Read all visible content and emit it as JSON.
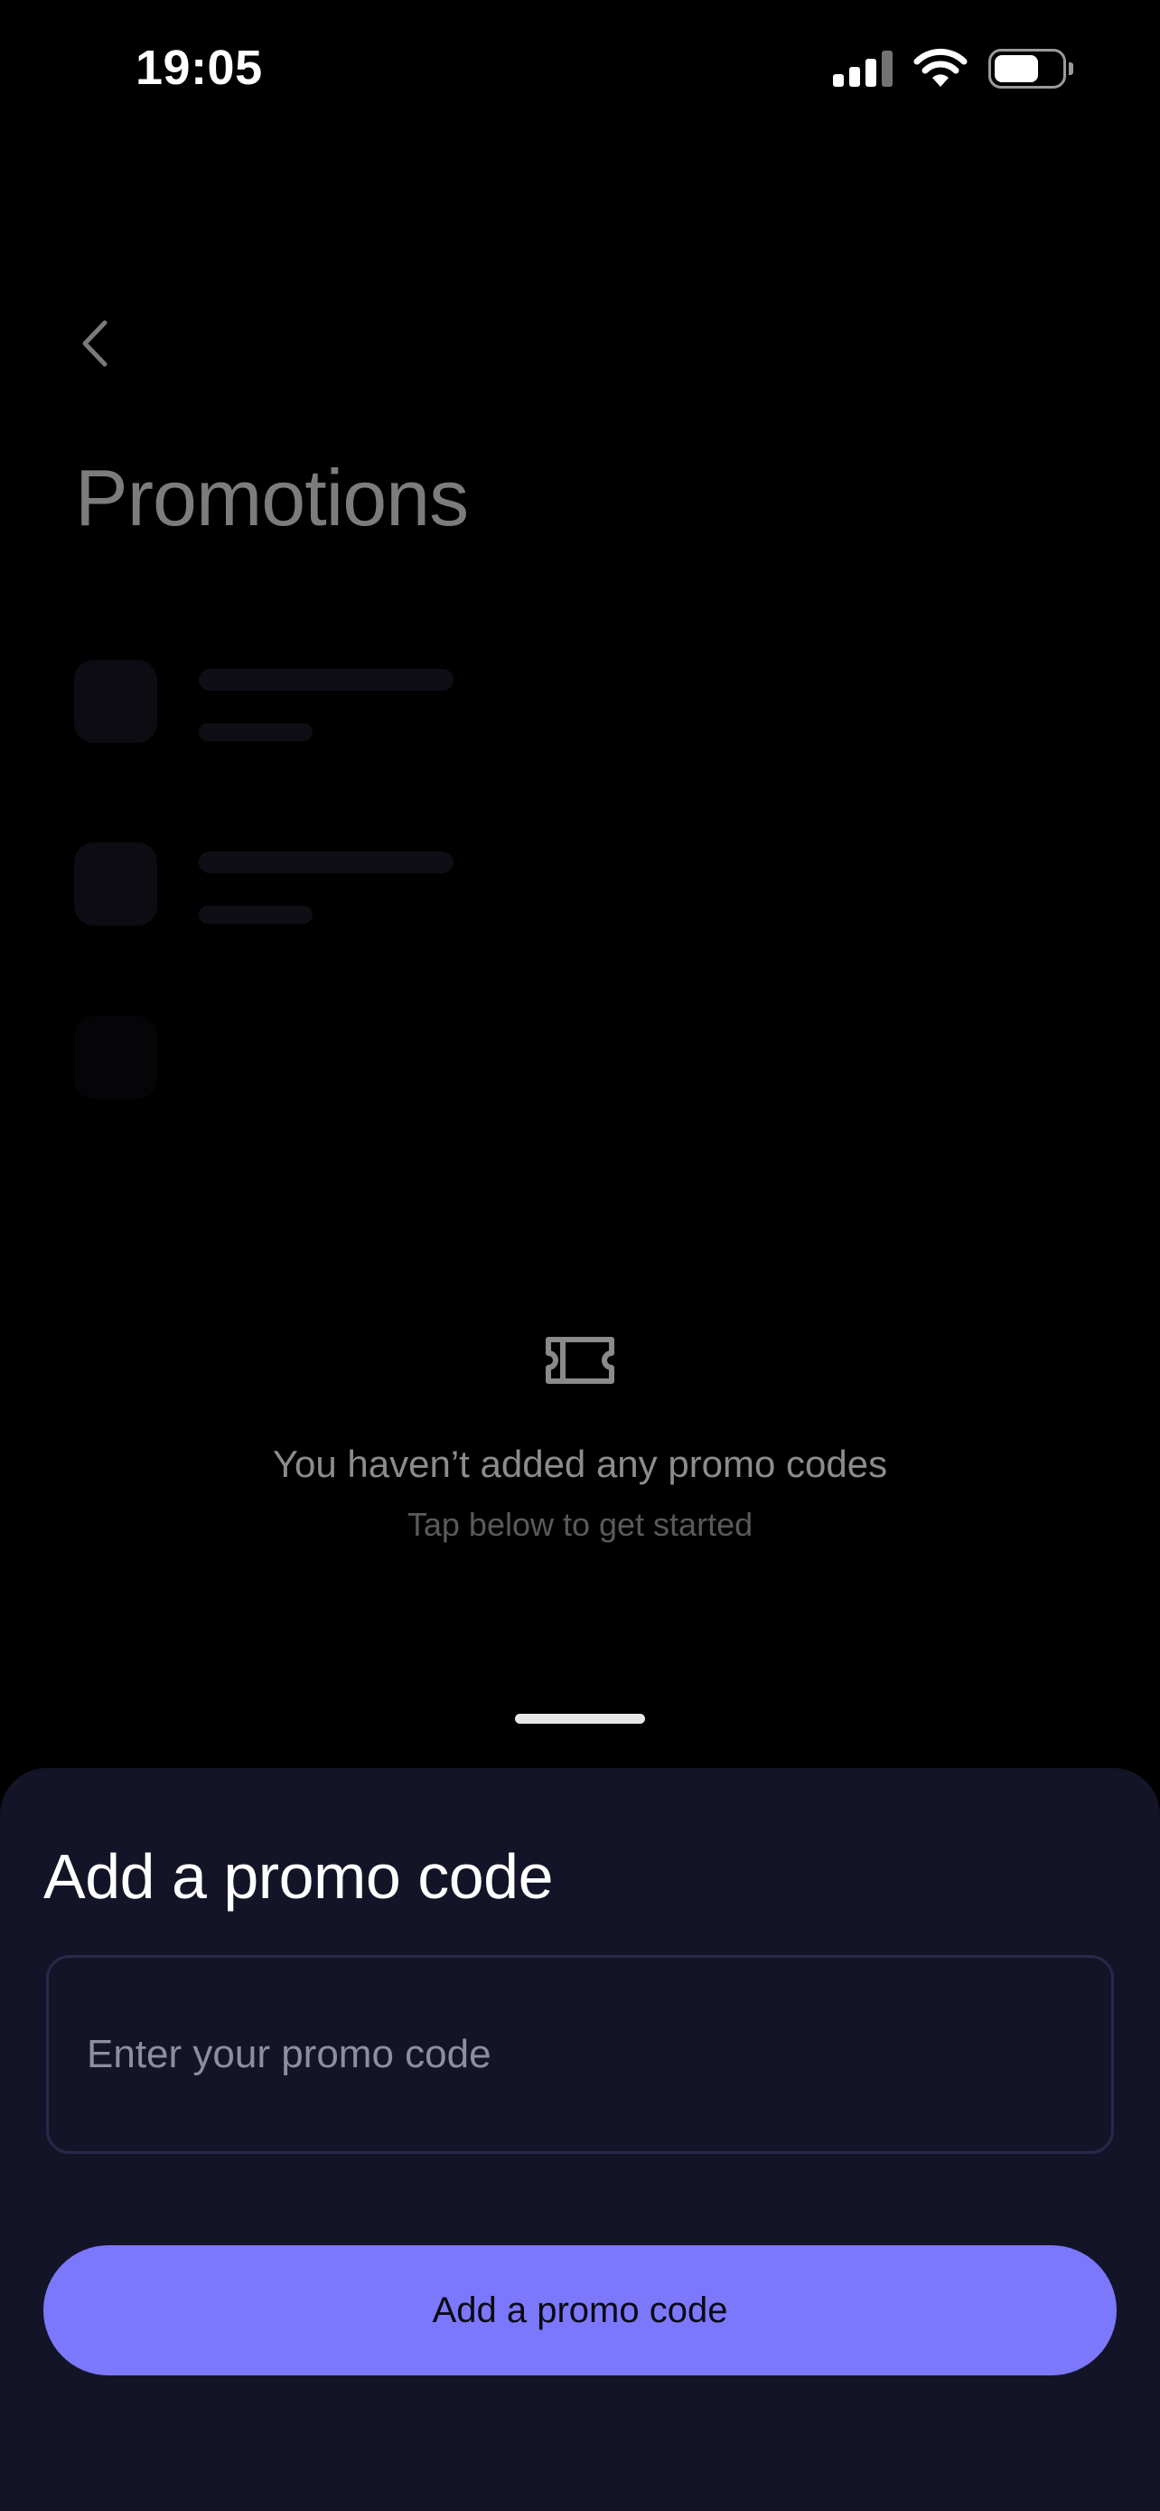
{
  "status_bar": {
    "time": "19:05",
    "icons": [
      "cellular-signal-icon",
      "wifi-icon",
      "battery-icon"
    ]
  },
  "page": {
    "back_icon": "chevron-left-icon",
    "title": "Promotions"
  },
  "empty_state": {
    "icon": "ticket-icon",
    "title": "You haven’t added any promo codes",
    "subtitle": "Tap below to get started"
  },
  "sheet": {
    "title": "Add a promo code",
    "input": {
      "placeholder": "Enter your promo code",
      "value": ""
    },
    "submit_label": "Add a promo code"
  },
  "colors": {
    "background": "#000000",
    "sheet_background": "#141428",
    "accent": "#7b78fc",
    "input_border": "#28284a"
  }
}
